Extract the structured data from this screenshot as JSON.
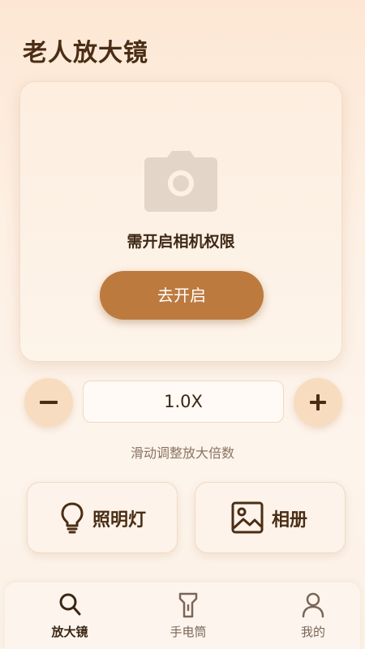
{
  "app": {
    "title": "老人放大镜"
  },
  "camera": {
    "icon": "camera-icon",
    "permission_text": "需开启相机权限",
    "open_button_label": "去开启"
  },
  "zoom": {
    "value": "1.0X",
    "hint": "滑动调整放大倍数",
    "decrease_icon": "minus-icon",
    "increase_icon": "plus-icon"
  },
  "features": [
    {
      "label": "照明灯",
      "icon": "lightbulb-icon"
    },
    {
      "label": "相册",
      "icon": "image-icon"
    }
  ],
  "nav": {
    "items": [
      {
        "label": "放大镜",
        "icon": "search-icon",
        "active": true
      },
      {
        "label": "手电筒",
        "icon": "flashlight-icon",
        "active": false
      },
      {
        "label": "我的",
        "icon": "user-icon",
        "active": false
      }
    ]
  },
  "colors": {
    "accent": "#bd7a3f",
    "round_button_bg": "#f8dcc0",
    "title_text": "#4a2d14"
  }
}
